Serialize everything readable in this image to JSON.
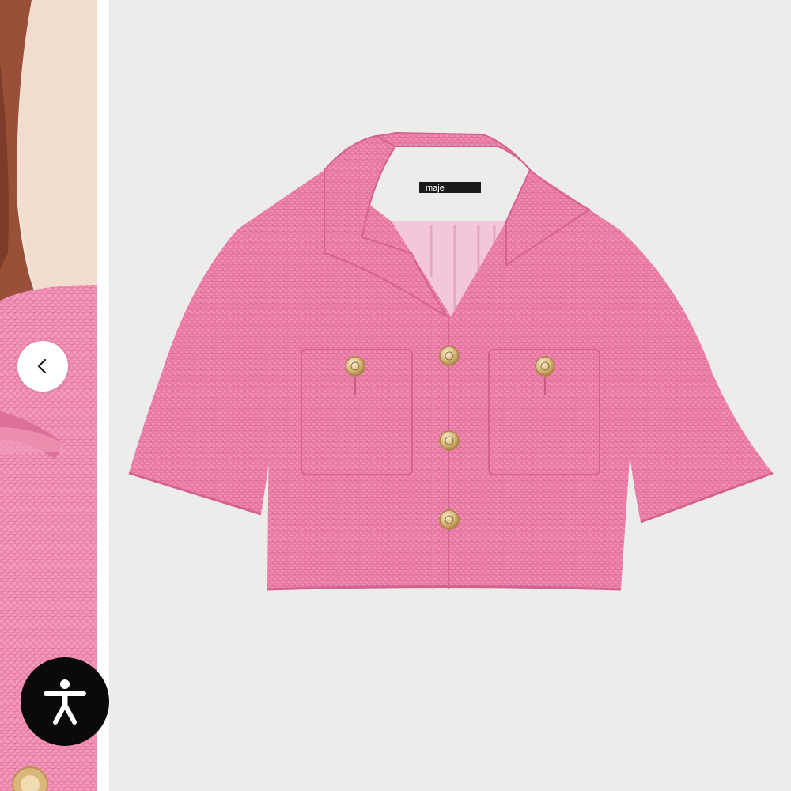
{
  "product": {
    "brand_label": "maje"
  },
  "controls": {
    "prev_icon": "chevron-left-icon",
    "accessibility_icon": "accessibility-person-icon"
  },
  "colors": {
    "jacket_pink": "#e97aa3",
    "background": "#ececea",
    "button_gold": "#d9b77a",
    "accessibility_bg": "#0a0a0a"
  }
}
